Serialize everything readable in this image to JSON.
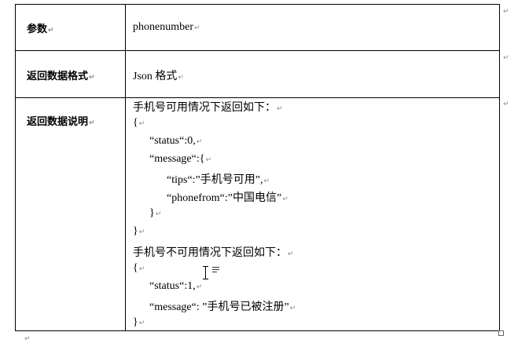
{
  "table": {
    "rows": [
      {
        "label": "参数",
        "value": "phonenumber"
      },
      {
        "label": "返回数据格式",
        "value": "Json 格式"
      },
      {
        "label": "返回数据说明"
      }
    ]
  },
  "description": {
    "available_intro": "手机号可用情况下返回如下：",
    "available_json": {
      "open_brace": "{",
      "status_line": "“status“:0,",
      "message_open": "“message“:{",
      "tips_line": "“tips“:”手机号可用”,",
      "phonefrom_line": "“phonefrom“:”中国电信”",
      "inner_close": "}",
      "outer_close": "}"
    },
    "unavailable_intro": "手机号不可用情况下返回如下：",
    "unavailable_json": {
      "open_brace": "{",
      "status_line": "“status“:1,",
      "message_line": "“message“: ”手机号已被注册”",
      "close_brace": "}"
    }
  },
  "marks": {
    "paragraph_mark": "↵"
  }
}
